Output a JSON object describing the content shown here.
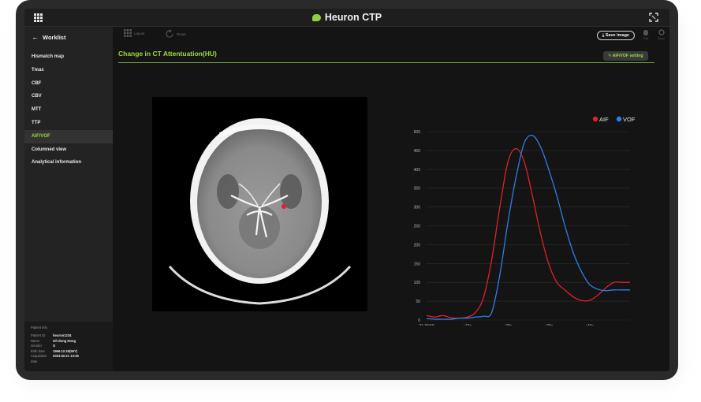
{
  "app": {
    "title": "Heuron CTP",
    "brand_color": "#8ed13e"
  },
  "sidebar": {
    "back_label": "Worklist",
    "items": [
      {
        "label": "Hismatch map",
        "active": false
      },
      {
        "label": "Tmax",
        "active": false
      },
      {
        "label": "CBF",
        "active": false
      },
      {
        "label": "CBV",
        "active": false
      },
      {
        "label": "MTT",
        "active": false
      },
      {
        "label": "TTP",
        "active": false
      },
      {
        "label": "AIF/VOF",
        "active": true
      },
      {
        "label": "Columned view",
        "active": false
      },
      {
        "label": "Analytical information",
        "active": false
      }
    ]
  },
  "patient": {
    "title": "Patient info",
    "rows": [
      {
        "key": "Patient ID",
        "value": "heuron1234"
      },
      {
        "key": "Name",
        "value": "Gil-dong Hong"
      },
      {
        "key": "Gender",
        "value": "G"
      },
      {
        "key": "Birth date",
        "value": "1966.12.25(56Y)"
      },
      {
        "key": "Acquisition date",
        "value": "2023.02.21 13:35"
      }
    ]
  },
  "toolbar": {
    "layout_label": "Layout",
    "reset_label": "Reset",
    "save_label": "Save image",
    "pan_label": "Pan",
    "zoom_label": "Zoom"
  },
  "main": {
    "title": "Change in CT Attentuation(HU)",
    "setting_label": "AIF/VOF setting"
  },
  "chart_data": {
    "type": "line",
    "x": [
      0,
      2,
      4,
      6,
      8,
      10,
      12,
      14,
      16,
      18,
      20,
      22,
      24,
      26,
      28,
      30,
      32,
      34,
      36,
      38,
      40,
      42,
      44,
      46,
      48,
      50
    ],
    "x_tick_labels": [
      "21:39:59",
      "+10s",
      "+20s",
      "+30s",
      "+40s"
    ],
    "x_tick_positions": [
      0,
      10,
      20,
      30,
      40
    ],
    "xlim": [
      0,
      50
    ],
    "ylim": [
      0,
      500
    ],
    "y_ticks": [
      0,
      50,
      100,
      150,
      200,
      250,
      300,
      350,
      400,
      450,
      500
    ],
    "grid": true,
    "legend_position": "top-right",
    "series": [
      {
        "name": "AIF",
        "color": "#e0202a",
        "values": [
          12,
          8,
          12,
          6,
          5,
          8,
          20,
          60,
          160,
          300,
          420,
          455,
          420,
          330,
          230,
          150,
          100,
          80,
          62,
          52,
          52,
          65,
          85,
          100,
          100,
          100
        ]
      },
      {
        "name": "VOF",
        "color": "#2f7de8",
        "values": [
          4,
          2,
          2,
          2,
          5,
          5,
          8,
          10,
          20,
          120,
          260,
          380,
          470,
          490,
          460,
          400,
          330,
          250,
          180,
          130,
          95,
          82,
          78,
          80,
          80,
          80
        ]
      }
    ]
  }
}
